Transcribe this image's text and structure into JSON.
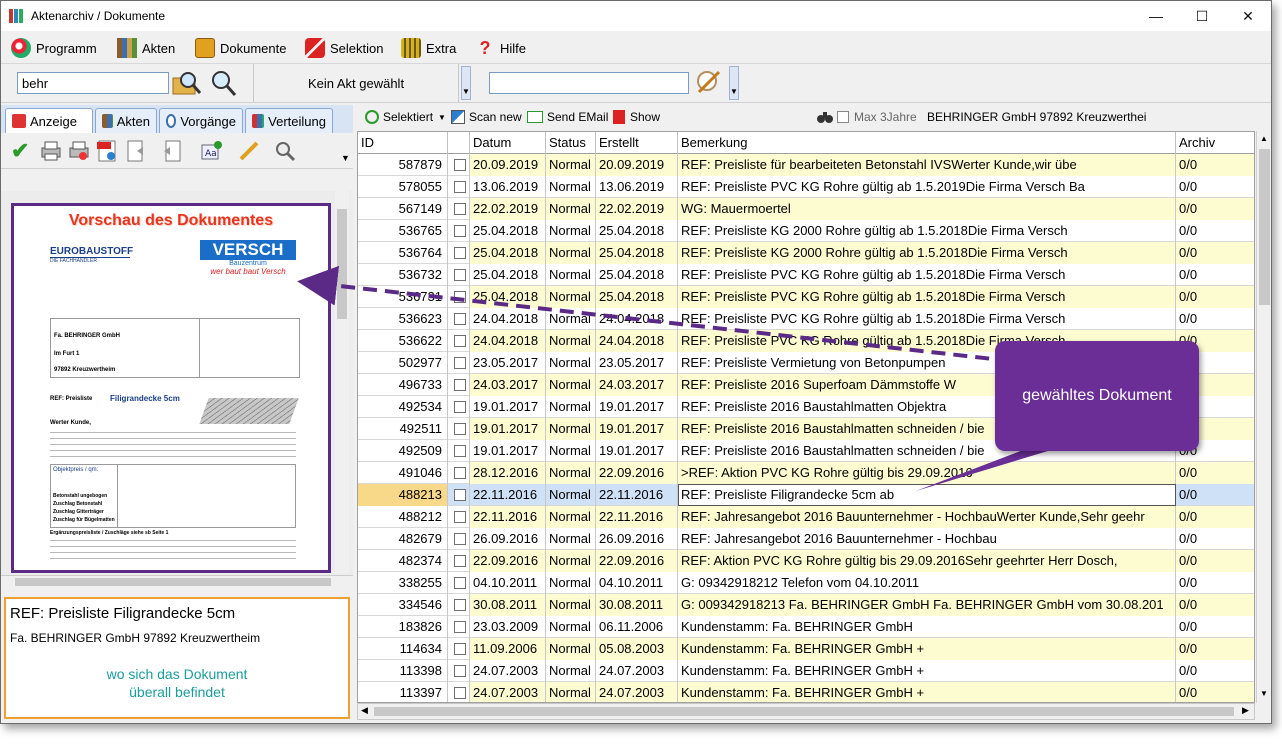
{
  "window": {
    "title": "Aktenarchiv / Dokumente",
    "buttons": {
      "minimize": "—",
      "maximize": "☐",
      "close": "✕"
    }
  },
  "menu": [
    {
      "label": "Programm",
      "icon": "program-icon"
    },
    {
      "label": "Akten",
      "icon": "books-icon"
    },
    {
      "label": "Dokumente",
      "icon": "briefcase-icon"
    },
    {
      "label": "Selektion",
      "icon": "selection-icon"
    },
    {
      "label": "Extra",
      "icon": "extra-icon"
    },
    {
      "label": "Hilfe",
      "icon": "help-icon"
    }
  ],
  "search": {
    "query": "behr",
    "akt_label": "Kein Akt gewählt",
    "second_query": ""
  },
  "tabs": [
    {
      "label": "Anzeige",
      "active": true
    },
    {
      "label": "Akten",
      "active": false
    },
    {
      "label": "Vorgänge",
      "active": false
    },
    {
      "label": "Verteilung",
      "active": false
    }
  ],
  "preview": {
    "title": "Vorschau des Dokumentes",
    "doc": {
      "logo_left_top": "EUROBAUSTOFF",
      "logo_left_bottom": "DIE FACHHÄNDLER",
      "logo_right": "VERSCH",
      "logo_right_sub": "Bauzentrum",
      "logo_right_slogan": "wer baut baut Versch",
      "recipient": "Fa. BEHRINGER GmbH",
      "attn": "Im Furt 1",
      "city": "97892 Kreuzwertheim",
      "subject_a": "REF:  Preisliste",
      "subject_b": "Filigrandecke 5cm",
      "salutation": "Werter Kunde,",
      "table_label": "Objektpreis / qm:",
      "row1": "Betonstahl ungebogen",
      "row2": "Zuschlag Betonstahl",
      "row3": "Zuschlag Gitterträger",
      "row4": "Zuschlag für Bügelmatten",
      "footer": "Ergänzungspreisliste / Zuschläge siehe sb Seite 1"
    }
  },
  "info": {
    "title": "REF:  Preisliste      Filigrandecke 5cm",
    "subtitle": "Fa. BEHRINGER GmbH 97892 Kreuzwertheim",
    "note_line1": "wo sich das Dokument",
    "note_line2": "überall befindet"
  },
  "right_toolbar": {
    "selektiert": "Selektiert",
    "scan_new": "Scan new",
    "send_email": "Send EMail",
    "show": "Show",
    "max_3jahre": "Max 3Jahre",
    "company": "BEHRINGER GmbH 97892 Kreuzwerthei"
  },
  "grid": {
    "headers": {
      "id": "ID",
      "datum": "Datum",
      "status": "Status",
      "erstellt": "Erstellt",
      "bemerkung": "Bemerkung",
      "archiv": "Archiv"
    },
    "rows": [
      {
        "id": "587879",
        "datum": "20.09.2019",
        "status": "Normal",
        "erstellt": "20.09.2019",
        "bemerkung": "REF:  Preisliste  für    bearbeiteten Betonstahl IVSWerter Kunde,wir übe",
        "archiv": "0/0",
        "hl": true
      },
      {
        "id": "578055",
        "datum": "13.06.2019",
        "status": "Normal",
        "erstellt": "13.06.2019",
        "bemerkung": "REF:  Preisliste      PVC KG Rohre gültig ab 1.5.2019Die Firma Versch Ba",
        "archiv": "0/0",
        "hl": false
      },
      {
        "id": "567149",
        "datum": "22.02.2019",
        "status": "Normal",
        "erstellt": "22.02.2019",
        "bemerkung": "WG: Mauermoertel",
        "archiv": "0/0",
        "hl": true
      },
      {
        "id": "536765",
        "datum": "25.04.2018",
        "status": "Normal",
        "erstellt": "25.04.2018",
        "bemerkung": "REF:  Preisliste      KG 2000 Rohre gültig ab 1.5.2018Die Firma Versch",
        "archiv": "0/0",
        "hl": false
      },
      {
        "id": "536764",
        "datum": "25.04.2018",
        "status": "Normal",
        "erstellt": "25.04.2018",
        "bemerkung": "REF:  Preisliste      KG 2000 Rohre gültig ab 1.5.2018Die Firma Versch",
        "archiv": "0/0",
        "hl": true
      },
      {
        "id": "536732",
        "datum": "25.04.2018",
        "status": "Normal",
        "erstellt": "25.04.2018",
        "bemerkung": "REF:  Preisliste      PVC KG Rohre gültig ab 1.5.2018Die Firma Versch",
        "archiv": "0/0",
        "hl": false
      },
      {
        "id": "536731",
        "datum": "25.04.2018",
        "status": "Normal",
        "erstellt": "25.04.2018",
        "bemerkung": "REF:  Preisliste      PVC KG Rohre gültig ab 1.5.2018Die Firma Versch",
        "archiv": "0/0",
        "hl": true
      },
      {
        "id": "536623",
        "datum": "24.04.2018",
        "status": "Normal",
        "erstellt": "24.04.2018",
        "bemerkung": "REF:  Preisliste      PVC KG Rohre gültig ab 1.5.2018Die Firma Versch",
        "archiv": "0/0",
        "hl": false
      },
      {
        "id": "536622",
        "datum": "24.04.2018",
        "status": "Normal",
        "erstellt": "24.04.2018",
        "bemerkung": "REF:  Preisliste      PVC KG Rohre gültig ab 1.5.2018Die Firma Versch",
        "archiv": "0/0",
        "hl": true
      },
      {
        "id": "502977",
        "datum": "23.05.2017",
        "status": "Normal",
        "erstellt": "23.05.2017",
        "bemerkung": "REF:  Preisliste Vermietung von Betonpumpen",
        "archiv": "0/0",
        "hl": false
      },
      {
        "id": "496733",
        "datum": "24.03.2017",
        "status": "Normal",
        "erstellt": "24.03.2017",
        "bemerkung": "REF:    Preisliste 2016   Superfoam Dämmstoffe      W",
        "archiv": "0/0",
        "hl": true
      },
      {
        "id": "492534",
        "datum": "19.01.2017",
        "status": "Normal",
        "erstellt": "19.01.2017",
        "bemerkung": "REF:   Preisliste 2016  Baustahlmatten           Objektra",
        "archiv": "0/0",
        "hl": false
      },
      {
        "id": "492511",
        "datum": "19.01.2017",
        "status": "Normal",
        "erstellt": "19.01.2017",
        "bemerkung": "REF:   Preisliste 2016  Baustahlmatten schneiden / bie",
        "archiv": "0/0",
        "hl": true
      },
      {
        "id": "492509",
        "datum": "19.01.2017",
        "status": "Normal",
        "erstellt": "19.01.2017",
        "bemerkung": "REF:   Preisliste 2016  Baustahlmatten schneiden / bie",
        "archiv": "0/0",
        "hl": false
      },
      {
        "id": "491046",
        "datum": "28.12.2016",
        "status": "Normal",
        "erstellt": "22.09.2016",
        "bemerkung": ">REF:  Aktion      PVC KG Rohre gültig bis 29.09.2016",
        "archiv": "0/0",
        "hl": true
      },
      {
        "id": "488213",
        "datum": "22.11.2016",
        "status": "Normal",
        "erstellt": "22.11.2016",
        "bemerkung": "REF:  Preisliste      Filigrandecke 5cm                                      ab",
        "archiv": "0/0",
        "hl": false,
        "selected": true
      },
      {
        "id": "488212",
        "datum": "22.11.2016",
        "status": "Normal",
        "erstellt": "22.11.2016",
        "bemerkung": "REF:   Jahresangebot 2016    Bauunternehmer - HochbauWerter Kunde,Sehr geehr",
        "archiv": "0/0",
        "hl": true
      },
      {
        "id": "482679",
        "datum": "26.09.2016",
        "status": "Normal",
        "erstellt": "26.09.2016",
        "bemerkung": "REF:  Jahresangebot 2016     Bauunternehmer - Hochbau",
        "archiv": "0/0",
        "hl": false
      },
      {
        "id": "482374",
        "datum": "22.09.2016",
        "status": "Normal",
        "erstellt": "22.09.2016",
        "bemerkung": "REF:  Aktion      PVC KG Rohre gültig bis 29.09.2016Sehr geehrter Herr Dosch,",
        "archiv": "0/0",
        "hl": true
      },
      {
        "id": "338255",
        "datum": "04.10.2011",
        "status": "Normal",
        "erstellt": "04.10.2011",
        "bemerkung": "G: 09342918212 Telefon vom 04.10.2011",
        "archiv": "0/0",
        "hl": false
      },
      {
        "id": "334546",
        "datum": "30.08.2011",
        "status": "Normal",
        "erstellt": "30.08.2011",
        "bemerkung": "G:  009342918213 Fa.  BEHRINGER GmbH Fa. BEHRINGER GmbH vom  30.08.201",
        "archiv": "0/0",
        "hl": true
      },
      {
        "id": "183826",
        "datum": "23.03.2009",
        "status": "Normal",
        "erstellt": "06.11.2006",
        "bemerkung": "Kundenstamm: Fa. BEHRINGER GmbH",
        "archiv": "0/0",
        "hl": false
      },
      {
        "id": "114634",
        "datum": "11.09.2006",
        "status": "Normal",
        "erstellt": "05.08.2003",
        "bemerkung": "Kundenstamm: Fa. BEHRINGER GmbH        +",
        "archiv": "0/0",
        "hl": true
      },
      {
        "id": "113398",
        "datum": "24.07.2003",
        "status": "Normal",
        "erstellt": "24.07.2003",
        "bemerkung": "Kundenstamm: Fa. BEHRINGER GmbH        +",
        "archiv": "0/0",
        "hl": false
      },
      {
        "id": "113397",
        "datum": "24.07.2003",
        "status": "Normal",
        "erstellt": "24.07.2003",
        "bemerkung": "Kundenstamm: Fa. BEHRINGER GmbH        +",
        "archiv": "0/0",
        "hl": true
      }
    ]
  },
  "callout": {
    "label": "gewähltes Dokument"
  },
  "colors": {
    "row_highlight": "#fdfbd0",
    "selected_row": "#cfe1f7",
    "selected_id": "#f8d98a",
    "callout": "#6a2e96",
    "preview_border": "#5b2a86",
    "info_border": "#f0a030"
  }
}
